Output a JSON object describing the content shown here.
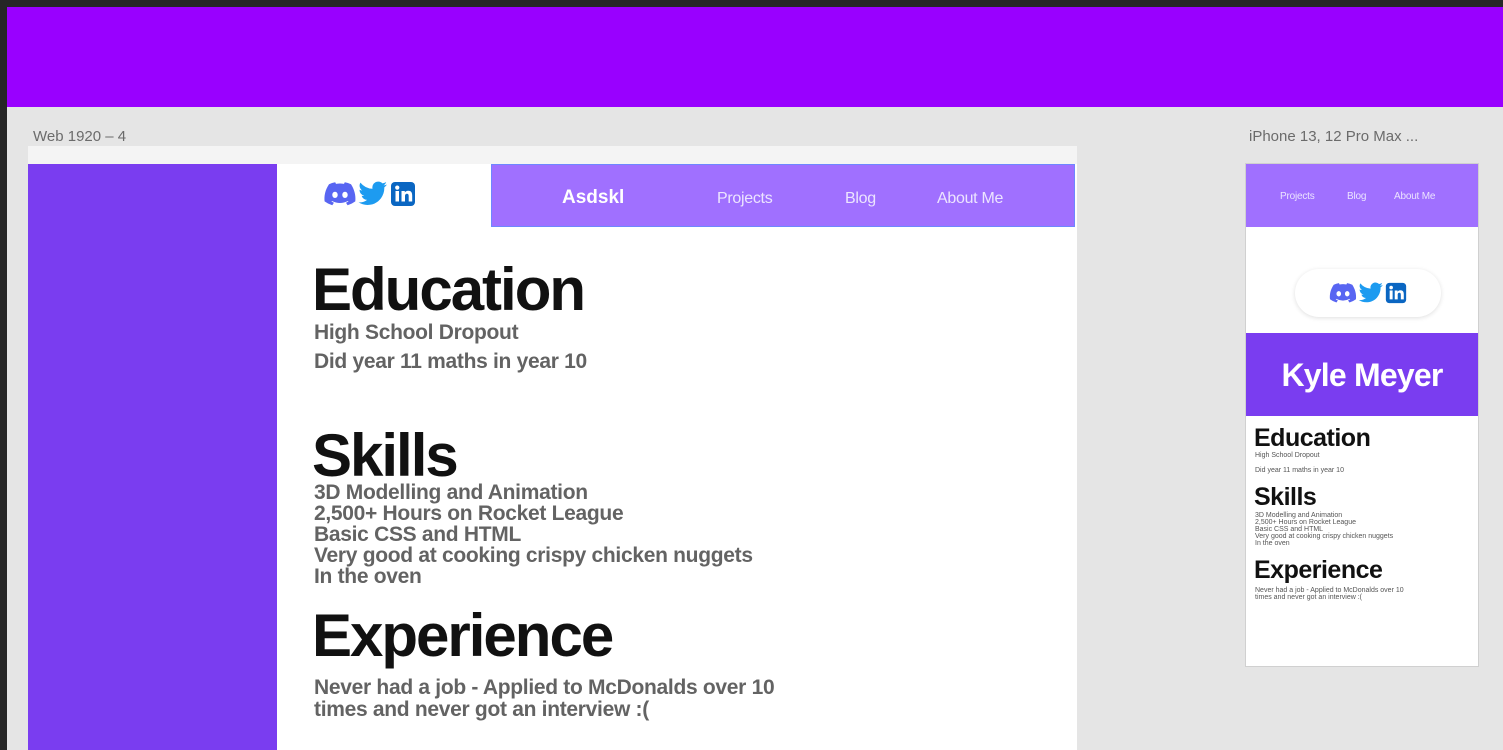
{
  "frames": {
    "desktop_label": "Web 1920 – 4",
    "mobile_label": "iPhone 13, 12 Pro Max ..."
  },
  "colors": {
    "top_banner": "#9900ff",
    "sidebar": "#7a3df0",
    "nav_bar": "#a070ff",
    "discord_icon": "#5865f2",
    "twitter_icon": "#1d9bf0",
    "linkedin_icon": "#0a66c2"
  },
  "icons": [
    "discord-icon",
    "twitter-icon",
    "linkedin-icon"
  ],
  "desktop": {
    "nav": {
      "brand": "Asdskl",
      "links": [
        "Projects",
        "Blog",
        "About Me"
      ]
    },
    "education": {
      "heading": "Education",
      "lines": [
        "High School Dropout",
        "Did year 11 maths in year 10"
      ]
    },
    "skills": {
      "heading": "Skills",
      "items": [
        "3D Modelling and Animation",
        "2,500+ Hours on Rocket League",
        "Basic CSS and HTML",
        "Very good at cooking crispy chicken nuggets",
        "In the oven"
      ]
    },
    "experience": {
      "heading": "Experience",
      "lines": [
        "Never had a job - Applied to McDonalds over 10",
        "times and never got an interview :("
      ]
    }
  },
  "mobile": {
    "nav": {
      "links": [
        "Projects",
        "Blog",
        "About Me"
      ]
    },
    "name": "Kyle Meyer",
    "education": {
      "heading": "Education",
      "lines": [
        "High School Dropout",
        "Did year 11 maths in year 10"
      ]
    },
    "skills": {
      "heading": "Skills",
      "items": [
        "3D Modelling and Animation",
        "2,500+ Hours on Rocket League",
        "Basic CSS and HTML",
        "Very good at cooking crispy chicken nuggets",
        "In the oven"
      ]
    },
    "experience": {
      "heading": "Experience",
      "lines": [
        "Never had a job - Applied to McDonalds over 10",
        "times and never got an interview :("
      ]
    }
  }
}
